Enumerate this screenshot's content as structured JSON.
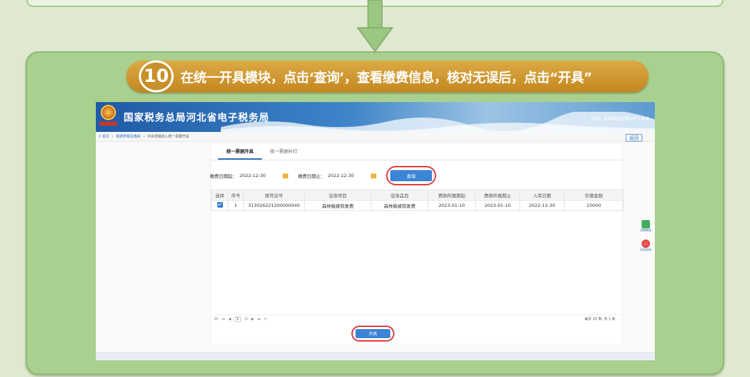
{
  "step": {
    "number": "10",
    "text": "在统一开具模块，点击‘查询’，查看缴费信息，核对无误后，点击“开具”"
  },
  "app": {
    "title": "国家税务总局河北省电子税务局",
    "welcome": "欢迎，测试税务有限公司 | 退出",
    "back_label": "返回"
  },
  "breadcrumb": [
    "首页",
    "税费申报及缴纳",
    "中央非税收入统一票据开具"
  ],
  "tabs": [
    {
      "label": "统一票据开具",
      "active": true
    },
    {
      "label": "统一票据补打",
      "active": false
    }
  ],
  "filters": {
    "start_label": "缴费日期起：",
    "start_value": "2022-12-30",
    "end_label": "缴费日期止：",
    "end_value": "2022-12-30",
    "query_label": "查询"
  },
  "table": {
    "headers": [
      "选择",
      "序号",
      "原凭证号",
      "征收项目",
      "征收品目",
      "费款所属期起",
      "费款所属期止",
      "入库日期",
      "实缴金额"
    ],
    "rows": [
      {
        "seq": "1",
        "voucher": "313026221200000040",
        "item": "森林植被恢复费",
        "subitem": "森林植被恢复费",
        "period_start": "2023-01-10",
        "period_end": "2023-01-10",
        "storage_date": "2022-12-30",
        "amount": "10000"
      }
    ]
  },
  "pager": {
    "page_size": "25",
    "page": "1",
    "total_pages": "/1",
    "summary": "每页 25 条, 共 1 条"
  },
  "open_label": "开具",
  "side_tools": [
    "视频教程",
    "在线咨询"
  ],
  "colors": {
    "panel_green": "#a9d08e",
    "banner_gold": "#c8902a",
    "primary_blue": "#3c84d6",
    "highlight_red": "#e03a3a"
  }
}
